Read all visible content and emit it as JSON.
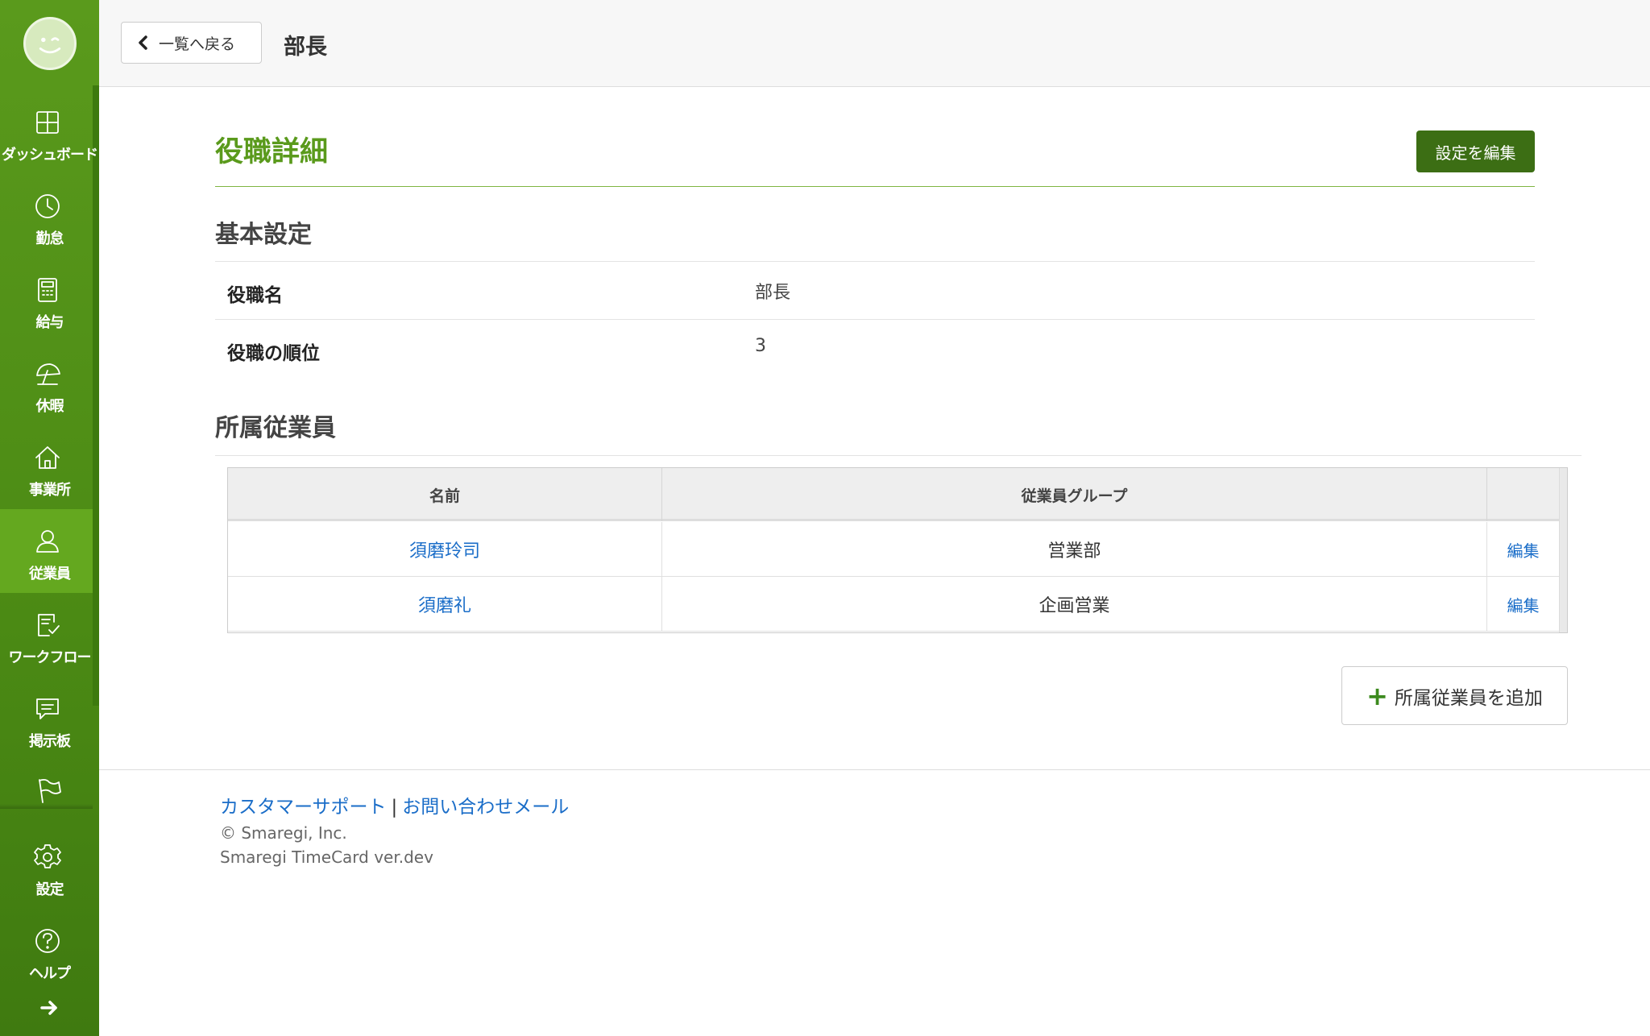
{
  "header": {
    "back_label": "一覧へ戻る",
    "title": "部長"
  },
  "sidebar": {
    "items": [
      {
        "label": "ダッシュボード",
        "icon": "dashboard-icon"
      },
      {
        "label": "勤怠",
        "icon": "clock-icon"
      },
      {
        "label": "給与",
        "icon": "calculator-icon"
      },
      {
        "label": "休暇",
        "icon": "umbrella-icon"
      },
      {
        "label": "事業所",
        "icon": "home-icon"
      },
      {
        "label": "従業員",
        "icon": "user-icon",
        "active": true
      },
      {
        "label": "ワークフロー",
        "icon": "checklist-icon"
      },
      {
        "label": "掲示板",
        "icon": "message-icon"
      },
      {
        "label": "",
        "icon": "flag-icon"
      },
      {
        "label": "設定",
        "icon": "gear-icon"
      },
      {
        "label": "ヘルプ",
        "icon": "help-icon"
      }
    ],
    "accent_color": "#4b8a14",
    "active_color": "#64a81f"
  },
  "main": {
    "section_title": "役職詳細",
    "edit_button_label": "設定を編集",
    "basic_settings": {
      "heading": "基本設定",
      "rows": [
        {
          "label": "役職名",
          "value": "部長"
        },
        {
          "label": "役職の順位",
          "value": "3"
        }
      ]
    },
    "employees": {
      "heading": "所属従業員",
      "columns": [
        "名前",
        "従業員グループ",
        ""
      ],
      "rows": [
        {
          "name": "須磨玲司",
          "group": "営業部",
          "action": "編集"
        },
        {
          "name": "須磨礼",
          "group": "企画営業",
          "action": "編集"
        }
      ],
      "add_button_label": "所属従業員を追加"
    }
  },
  "footer": {
    "support_link": "カスタマーサポート",
    "separator": "|",
    "contact_link": "お問い合わせメール",
    "copyright": "© Smaregi, Inc.",
    "version": "Smaregi TimeCard ver.dev"
  }
}
